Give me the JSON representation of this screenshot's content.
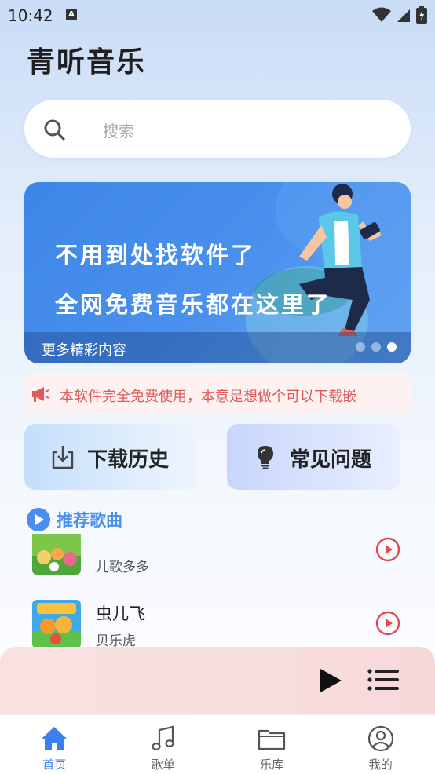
{
  "status_bar": {
    "time": "10:42",
    "notification_glyph": "A"
  },
  "app": {
    "title": "青听音乐"
  },
  "search": {
    "placeholder": "搜索"
  },
  "banner": {
    "line1": "不用到处找软件了",
    "line2": "全网免费音乐都在这里了",
    "more": "更多精彩内容",
    "slide_count": 3,
    "active_slide": 3
  },
  "notice": {
    "text": "本软件完全免费使用，本意是想做个可以下载嵌"
  },
  "quick_actions": {
    "download": "下载历史",
    "faq": "常见问题"
  },
  "section": {
    "title": "推荐歌曲"
  },
  "songs": [
    {
      "title": "",
      "artist": "儿歌多多",
      "cover_icon": "kids-cartoon-cover"
    },
    {
      "title": "虫儿飞",
      "artist": "贝乐虎",
      "cover_icon": "kids-cartoon-cover"
    }
  ],
  "tabs": [
    {
      "label": "首页",
      "icon": "home-icon",
      "active": true
    },
    {
      "label": "歌单",
      "icon": "music-note-icon",
      "active": false
    },
    {
      "label": "乐库",
      "icon": "folder-icon",
      "active": false
    },
    {
      "label": "我的",
      "icon": "profile-icon",
      "active": false
    }
  ],
  "colors": {
    "accent": "#3b7ff0",
    "section_accent": "#4a8ff0",
    "notice_text": "#e05a5a",
    "play_red": "#e6474f"
  }
}
